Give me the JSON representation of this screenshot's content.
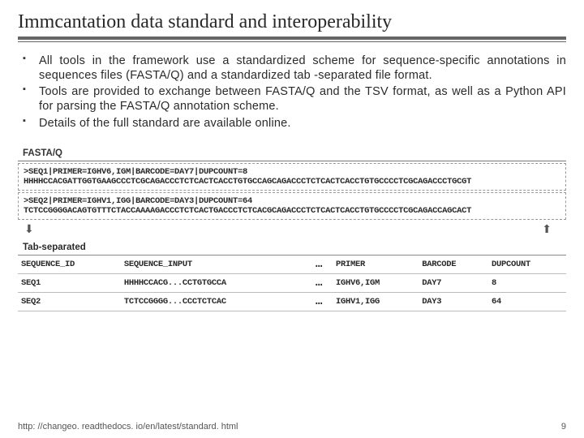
{
  "title": "Immcantation data standard and interoperability",
  "bullets": [
    "All tools in the framework use a standardized scheme for sequence-specific annotations in sequences files (FASTA/Q) and a standardized tab -separated file format.",
    "Tools are provided to exchange between FASTA/Q and the TSV format, as well as a Python API for parsing the FASTA/Q annotation scheme.",
    "Details of the full standard are available online."
  ],
  "fastaq": {
    "label": "FASTA/Q",
    "rec1_header": ">SEQ1|PRIMER=IGHV6,IGM|BARCODE=DAY7|DUPCOUNT=8",
    "rec1_seq": "HHHHCCACGATTGGTGAAGCCCTCGCAGACCCTCTCACTCACCTGTGCCAGCAGACCCTCTCACTCACCTGTGCCCCTCGCAGACCCTGCGT",
    "rec2_header": ">SEQ2|PRIMER=IGHV1,IGG|BARCODE=DAY3|DUPCOUNT=64",
    "rec2_seq": "TCTCCGGGGACAGTGTTTCTACCAAAAGACCCTCTCACTGACCCTCTCACGCAGACCCTCTCACTCACCTGTGCCCCTCGCAGACCAGCACT"
  },
  "tab": {
    "label": "Tab-separated",
    "headers": {
      "c1": "SEQUENCE_ID",
      "c2": "SEQUENCE_INPUT",
      "c3": "PRIMER",
      "c4": "BARCODE",
      "c5": "DUPCOUNT"
    },
    "rows": [
      {
        "c1": "SEQ1",
        "c2": "HHHHCCACG...CCTGTGCCA",
        "c3": "IGHV6,IGM",
        "c4": "DAY7",
        "c5": "8"
      },
      {
        "c1": "SEQ2",
        "c2": "TCTCCGGGG...CCCTCTCAC",
        "c3": "IGHV1,IGG",
        "c4": "DAY3",
        "c5": "64"
      }
    ]
  },
  "footer": {
    "url": "http: //changeo. readthedocs. io/en/latest/standard. html",
    "page": "9"
  },
  "ellipsis": "…"
}
